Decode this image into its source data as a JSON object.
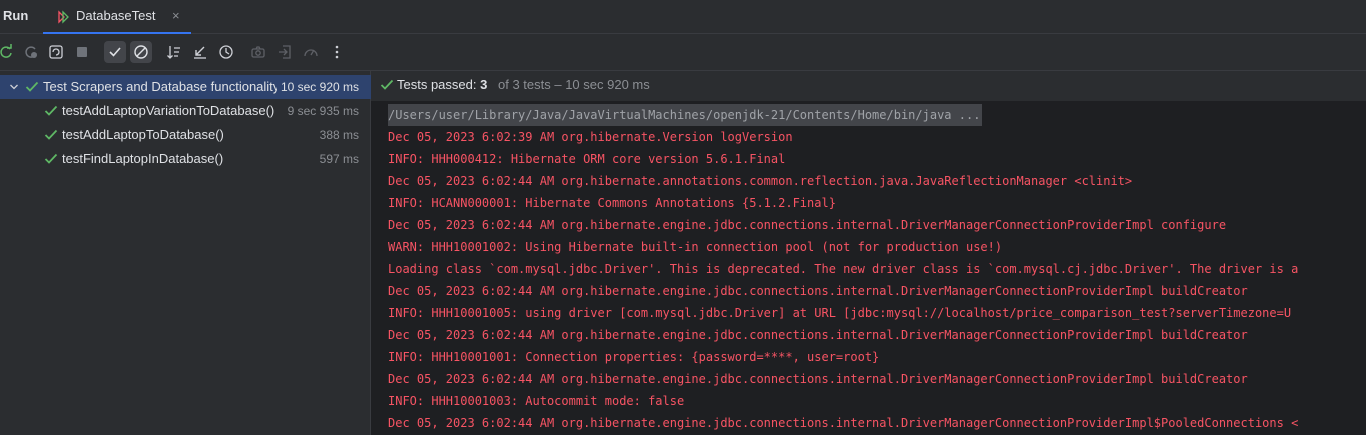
{
  "tabbar": {
    "tool_title": "Run",
    "tab_label": "DatabaseTest",
    "tab_close": "×"
  },
  "toolbar": {
    "buttons": [
      "rerun-icon",
      "rerun-failed-icon",
      "toggle-auto-test-icon",
      "stop-icon",
      "show-passed-icon",
      "show-ignored-icon",
      "sort-alphabetically-icon",
      "collapse-icon",
      "sort-by-duration-icon",
      "camera-icon",
      "import-icon",
      "gauge-icon",
      "more-icon"
    ]
  },
  "tree": {
    "root": {
      "name": "Test Scrapers and Database functionality",
      "time": "10 sec 920 ms"
    },
    "items": [
      {
        "name": "testAddLaptopVariationToDatabase()",
        "time": "9 sec 935 ms"
      },
      {
        "name": "testAddLaptopToDatabase()",
        "time": "388 ms"
      },
      {
        "name": "testFindLaptopInDatabase()",
        "time": "597 ms"
      }
    ]
  },
  "status": {
    "passed_label": "Tests passed: ",
    "passed_count": "3",
    "rest": "of 3 tests – 10 sec 920 ms"
  },
  "console": {
    "lines": [
      "/Users/user/Library/Java/JavaVirtualMachines/openjdk-21/Contents/Home/bin/java ...",
      "Dec 05, 2023 6:02:39 AM org.hibernate.Version logVersion",
      "INFO: HHH000412: Hibernate ORM core version 5.6.1.Final",
      "Dec 05, 2023 6:02:44 AM org.hibernate.annotations.common.reflection.java.JavaReflectionManager <clinit>",
      "INFO: HCANN000001: Hibernate Commons Annotations {5.1.2.Final}",
      "Dec 05, 2023 6:02:44 AM org.hibernate.engine.jdbc.connections.internal.DriverManagerConnectionProviderImpl configure",
      "WARN: HHH10001002: Using Hibernate built-in connection pool (not for production use!)",
      "Loading class `com.mysql.jdbc.Driver'. This is deprecated. The new driver class is `com.mysql.cj.jdbc.Driver'. The driver is a",
      "Dec 05, 2023 6:02:44 AM org.hibernate.engine.jdbc.connections.internal.DriverManagerConnectionProviderImpl buildCreator",
      "INFO: HHH10001005: using driver [com.mysql.jdbc.Driver] at URL [jdbc:mysql://localhost/price_comparison_test?serverTimezone=U",
      "Dec 05, 2023 6:02:44 AM org.hibernate.engine.jdbc.connections.internal.DriverManagerConnectionProviderImpl buildCreator",
      "INFO: HHH10001001: Connection properties: {password=****, user=root}",
      "Dec 05, 2023 6:02:44 AM org.hibernate.engine.jdbc.connections.internal.DriverManagerConnectionProviderImpl buildCreator",
      "INFO: HHH10001003: Autocommit mode: false",
      "Dec 05, 2023 6:02:44 AM org.hibernate.engine.jdbc.connections.internal.DriverManagerConnectionProviderImpl$PooledConnections <"
    ]
  },
  "colors": {
    "pass_green": "#5fb865",
    "error_red": "#f75464",
    "accent": "#3574f0"
  }
}
